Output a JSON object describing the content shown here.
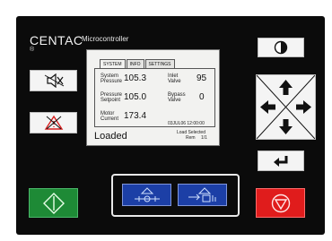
{
  "brand": {
    "name": "CENTAC",
    "subtitle": "Microcontroller",
    "mark": "®"
  },
  "tabs": [
    {
      "label": "SYSTEM",
      "active": true
    },
    {
      "label": "INFO",
      "active": false
    },
    {
      "label": "SETTINGS",
      "active": false
    }
  ],
  "readings": {
    "system_pressure": {
      "label_1": "System",
      "label_2": "Pressure",
      "value": "105.3"
    },
    "setpoint_pressure": {
      "label_1": "Pressure",
      "label_2": "Setpoint",
      "value": "105.0"
    },
    "motor_current": {
      "label_1": "Motor",
      "label_2": "Current",
      "value": "173.4"
    },
    "inlet_valve": {
      "label_1": "Inlet",
      "label_2": "Valve",
      "value": "95"
    },
    "bypass_valve": {
      "label_1": "Bypass",
      "label_2": "Valve",
      "value": "0"
    }
  },
  "datetime": "03JUL06 12:00:00",
  "status": "Loaded",
  "load_selected": {
    "line_1": "Load Selected",
    "line_2": "Rem",
    "line_3": "1/1"
  },
  "colors": {
    "panel": "#0b0b0b",
    "start": "#1e8a36",
    "stop": "#e01c1c",
    "mode": "#1c3fa6"
  },
  "icons": {
    "alarm_silence": "speaker-muted-icon",
    "alarm_reset": "warning-triangle-crossed-icon",
    "contrast": "contrast-icon",
    "enter": "enter-return-icon",
    "start": "start-diamond-icon",
    "stop": "stop-circle-triangle-icon",
    "mode_modulate": "modulate-mode-icon",
    "mode_autodual": "autodual-mode-icon"
  }
}
